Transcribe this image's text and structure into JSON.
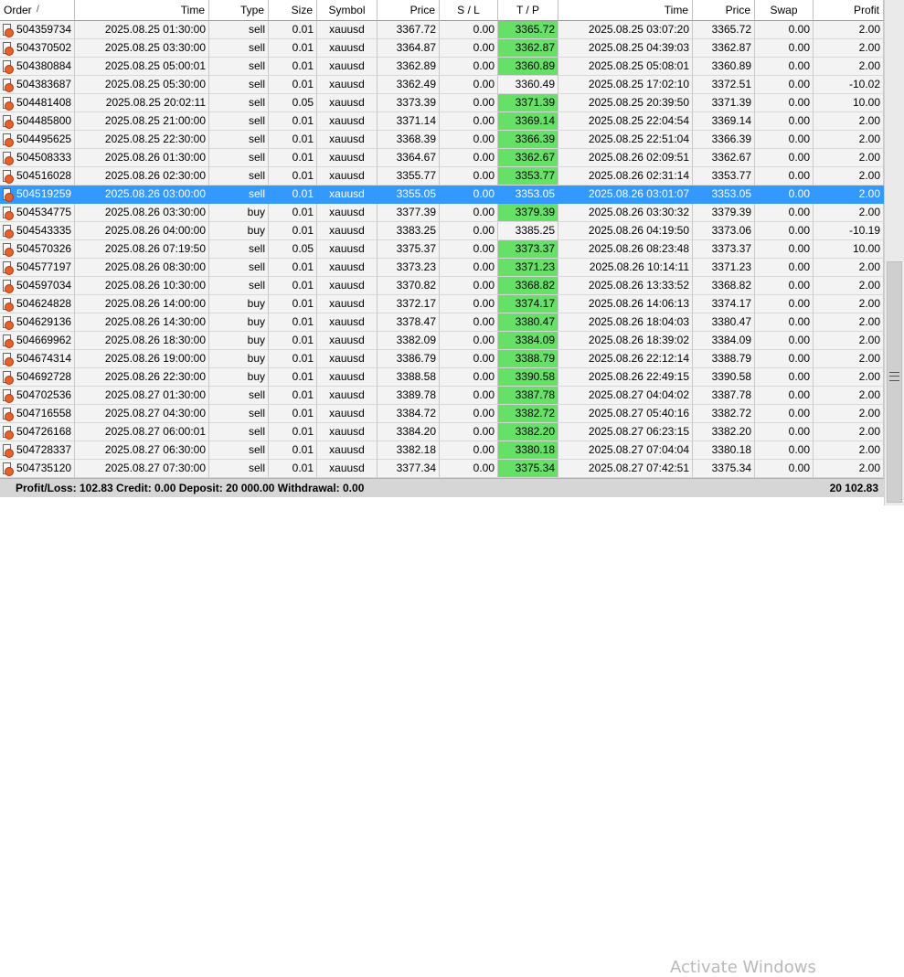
{
  "columns": {
    "order": "Order",
    "time": "Time",
    "type": "Type",
    "size": "Size",
    "symbol": "Symbol",
    "price": "Price",
    "sl": "S / L",
    "tp": "T / P",
    "close_time": "Time",
    "close_price": "Price",
    "swap": "Swap",
    "profit": "Profit",
    "sort_glyph": "/"
  },
  "rows": [
    {
      "order": "504359734",
      "time": "2025.08.25 01:30:00",
      "type": "sell",
      "size": "0.01",
      "symbol": "xauusd",
      "price": "3367.72",
      "sl": "0.00",
      "tp": "3365.72",
      "close_time": "2025.08.25 03:07:20",
      "close_price": "3365.72",
      "swap": "0.00",
      "profit": "2.00",
      "tp_hit": true
    },
    {
      "order": "504370502",
      "time": "2025.08.25 03:30:00",
      "type": "sell",
      "size": "0.01",
      "symbol": "xauusd",
      "price": "3364.87",
      "sl": "0.00",
      "tp": "3362.87",
      "close_time": "2025.08.25 04:39:03",
      "close_price": "3362.87",
      "swap": "0.00",
      "profit": "2.00",
      "tp_hit": true
    },
    {
      "order": "504380884",
      "time": "2025.08.25 05:00:01",
      "type": "sell",
      "size": "0.01",
      "symbol": "xauusd",
      "price": "3362.89",
      "sl": "0.00",
      "tp": "3360.89",
      "close_time": "2025.08.25 05:08:01",
      "close_price": "3360.89",
      "swap": "0.00",
      "profit": "2.00",
      "tp_hit": true
    },
    {
      "order": "504383687",
      "time": "2025.08.25 05:30:00",
      "type": "sell",
      "size": "0.01",
      "symbol": "xauusd",
      "price": "3362.49",
      "sl": "0.00",
      "tp": "3360.49",
      "close_time": "2025.08.25 17:02:10",
      "close_price": "3372.51",
      "swap": "0.00",
      "profit": "-10.02",
      "tp_hit": false
    },
    {
      "order": "504481408",
      "time": "2025.08.25 20:02:11",
      "type": "sell",
      "size": "0.05",
      "symbol": "xauusd",
      "price": "3373.39",
      "sl": "0.00",
      "tp": "3371.39",
      "close_time": "2025.08.25 20:39:50",
      "close_price": "3371.39",
      "swap": "0.00",
      "profit": "10.00",
      "tp_hit": true
    },
    {
      "order": "504485800",
      "time": "2025.08.25 21:00:00",
      "type": "sell",
      "size": "0.01",
      "symbol": "xauusd",
      "price": "3371.14",
      "sl": "0.00",
      "tp": "3369.14",
      "close_time": "2025.08.25 22:04:54",
      "close_price": "3369.14",
      "swap": "0.00",
      "profit": "2.00",
      "tp_hit": true
    },
    {
      "order": "504495625",
      "time": "2025.08.25 22:30:00",
      "type": "sell",
      "size": "0.01",
      "symbol": "xauusd",
      "price": "3368.39",
      "sl": "0.00",
      "tp": "3366.39",
      "close_time": "2025.08.25 22:51:04",
      "close_price": "3366.39",
      "swap": "0.00",
      "profit": "2.00",
      "tp_hit": true
    },
    {
      "order": "504508333",
      "time": "2025.08.26 01:30:00",
      "type": "sell",
      "size": "0.01",
      "symbol": "xauusd",
      "price": "3364.67",
      "sl": "0.00",
      "tp": "3362.67",
      "close_time": "2025.08.26 02:09:51",
      "close_price": "3362.67",
      "swap": "0.00",
      "profit": "2.00",
      "tp_hit": true
    },
    {
      "order": "504516028",
      "time": "2025.08.26 02:30:00",
      "type": "sell",
      "size": "0.01",
      "symbol": "xauusd",
      "price": "3355.77",
      "sl": "0.00",
      "tp": "3353.77",
      "close_time": "2025.08.26 02:31:14",
      "close_price": "3353.77",
      "swap": "0.00",
      "profit": "2.00",
      "tp_hit": true
    },
    {
      "order": "504519259",
      "time": "2025.08.26 03:00:00",
      "type": "sell",
      "size": "0.01",
      "symbol": "xauusd",
      "price": "3355.05",
      "sl": "0.00",
      "tp": "3353.05",
      "close_time": "2025.08.26 03:01:07",
      "close_price": "3353.05",
      "swap": "0.00",
      "profit": "2.00",
      "tp_hit": true,
      "selected": true
    },
    {
      "order": "504534775",
      "time": "2025.08.26 03:30:00",
      "type": "buy",
      "size": "0.01",
      "symbol": "xauusd",
      "price": "3377.39",
      "sl": "0.00",
      "tp": "3379.39",
      "close_time": "2025.08.26 03:30:32",
      "close_price": "3379.39",
      "swap": "0.00",
      "profit": "2.00",
      "tp_hit": true
    },
    {
      "order": "504543335",
      "time": "2025.08.26 04:00:00",
      "type": "buy",
      "size": "0.01",
      "symbol": "xauusd",
      "price": "3383.25",
      "sl": "0.00",
      "tp": "3385.25",
      "close_time": "2025.08.26 04:19:50",
      "close_price": "3373.06",
      "swap": "0.00",
      "profit": "-10.19",
      "tp_hit": false
    },
    {
      "order": "504570326",
      "time": "2025.08.26 07:19:50",
      "type": "sell",
      "size": "0.05",
      "symbol": "xauusd",
      "price": "3375.37",
      "sl": "0.00",
      "tp": "3373.37",
      "close_time": "2025.08.26 08:23:48",
      "close_price": "3373.37",
      "swap": "0.00",
      "profit": "10.00",
      "tp_hit": true
    },
    {
      "order": "504577197",
      "time": "2025.08.26 08:30:00",
      "type": "sell",
      "size": "0.01",
      "symbol": "xauusd",
      "price": "3373.23",
      "sl": "0.00",
      "tp": "3371.23",
      "close_time": "2025.08.26 10:14:11",
      "close_price": "3371.23",
      "swap": "0.00",
      "profit": "2.00",
      "tp_hit": true
    },
    {
      "order": "504597034",
      "time": "2025.08.26 10:30:00",
      "type": "sell",
      "size": "0.01",
      "symbol": "xauusd",
      "price": "3370.82",
      "sl": "0.00",
      "tp": "3368.82",
      "close_time": "2025.08.26 13:33:52",
      "close_price": "3368.82",
      "swap": "0.00",
      "profit": "2.00",
      "tp_hit": true
    },
    {
      "order": "504624828",
      "time": "2025.08.26 14:00:00",
      "type": "buy",
      "size": "0.01",
      "symbol": "xauusd",
      "price": "3372.17",
      "sl": "0.00",
      "tp": "3374.17",
      "close_time": "2025.08.26 14:06:13",
      "close_price": "3374.17",
      "swap": "0.00",
      "profit": "2.00",
      "tp_hit": true
    },
    {
      "order": "504629136",
      "time": "2025.08.26 14:30:00",
      "type": "buy",
      "size": "0.01",
      "symbol": "xauusd",
      "price": "3378.47",
      "sl": "0.00",
      "tp": "3380.47",
      "close_time": "2025.08.26 18:04:03",
      "close_price": "3380.47",
      "swap": "0.00",
      "profit": "2.00",
      "tp_hit": true
    },
    {
      "order": "504669962",
      "time": "2025.08.26 18:30:00",
      "type": "buy",
      "size": "0.01",
      "symbol": "xauusd",
      "price": "3382.09",
      "sl": "0.00",
      "tp": "3384.09",
      "close_time": "2025.08.26 18:39:02",
      "close_price": "3384.09",
      "swap": "0.00",
      "profit": "2.00",
      "tp_hit": true
    },
    {
      "order": "504674314",
      "time": "2025.08.26 19:00:00",
      "type": "buy",
      "size": "0.01",
      "symbol": "xauusd",
      "price": "3386.79",
      "sl": "0.00",
      "tp": "3388.79",
      "close_time": "2025.08.26 22:12:14",
      "close_price": "3388.79",
      "swap": "0.00",
      "profit": "2.00",
      "tp_hit": true
    },
    {
      "order": "504692728",
      "time": "2025.08.26 22:30:00",
      "type": "buy",
      "size": "0.01",
      "symbol": "xauusd",
      "price": "3388.58",
      "sl": "0.00",
      "tp": "3390.58",
      "close_time": "2025.08.26 22:49:15",
      "close_price": "3390.58",
      "swap": "0.00",
      "profit": "2.00",
      "tp_hit": true
    },
    {
      "order": "504702536",
      "time": "2025.08.27 01:30:00",
      "type": "sell",
      "size": "0.01",
      "symbol": "xauusd",
      "price": "3389.78",
      "sl": "0.00",
      "tp": "3387.78",
      "close_time": "2025.08.27 04:04:02",
      "close_price": "3387.78",
      "swap": "0.00",
      "profit": "2.00",
      "tp_hit": true
    },
    {
      "order": "504716558",
      "time": "2025.08.27 04:30:00",
      "type": "sell",
      "size": "0.01",
      "symbol": "xauusd",
      "price": "3384.72",
      "sl": "0.00",
      "tp": "3382.72",
      "close_time": "2025.08.27 05:40:16",
      "close_price": "3382.72",
      "swap": "0.00",
      "profit": "2.00",
      "tp_hit": true
    },
    {
      "order": "504726168",
      "time": "2025.08.27 06:00:01",
      "type": "sell",
      "size": "0.01",
      "symbol": "xauusd",
      "price": "3384.20",
      "sl": "0.00",
      "tp": "3382.20",
      "close_time": "2025.08.27 06:23:15",
      "close_price": "3382.20",
      "swap": "0.00",
      "profit": "2.00",
      "tp_hit": true
    },
    {
      "order": "504728337",
      "time": "2025.08.27 06:30:00",
      "type": "sell",
      "size": "0.01",
      "symbol": "xauusd",
      "price": "3382.18",
      "sl": "0.00",
      "tp": "3380.18",
      "close_time": "2025.08.27 07:04:04",
      "close_price": "3380.18",
      "swap": "0.00",
      "profit": "2.00",
      "tp_hit": true
    },
    {
      "order": "504735120",
      "time": "2025.08.27 07:30:00",
      "type": "sell",
      "size": "0.01",
      "symbol": "xauusd",
      "price": "3377.34",
      "sl": "0.00",
      "tp": "3375.34",
      "close_time": "2025.08.27 07:42:51",
      "close_price": "3375.34",
      "swap": "0.00",
      "profit": "2.00",
      "tp_hit": true
    }
  ],
  "summary": {
    "text": "Profit/Loss: 102.83  Credit: 0.00  Deposit: 20 000.00  Withdrawal: 0.00",
    "total": "20 102.83"
  },
  "watermark": "Activate Windows",
  "colors": {
    "tp_hit": "#66e066",
    "selected": "#3399ff",
    "summary_bg": "#d6d6d6",
    "order_icon": "#e8602c"
  },
  "icons": {
    "order": "order-sell-icon",
    "scroll_grip": "grip-icon"
  }
}
